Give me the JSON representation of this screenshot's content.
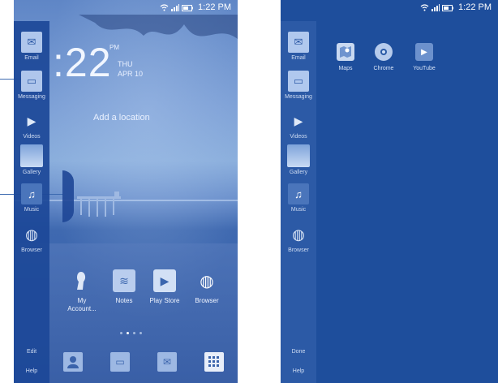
{
  "status": {
    "time": "1:22 PM",
    "wifi_icon": "wifi-icon",
    "signal_icon": "signal-icon",
    "battery_icon": "battery-icon"
  },
  "sidebar": {
    "items": [
      {
        "label": "Email",
        "icon": "email-icon"
      },
      {
        "label": "Messaging",
        "icon": "messaging-icon"
      },
      {
        "label": "Videos",
        "icon": "play-icon"
      },
      {
        "label": "Gallery",
        "icon": "gallery-icon"
      },
      {
        "label": "Music",
        "icon": "music-icon"
      },
      {
        "label": "Browser",
        "icon": "globe-icon"
      }
    ],
    "left_bottom": [
      "Edit",
      "Help"
    ],
    "right_bottom": [
      "Done",
      "Help"
    ]
  },
  "lockscreen": {
    "time": ":22",
    "ampm": "PM",
    "day": "THU",
    "date": "APR 10",
    "location": "Add a location"
  },
  "home_apps": [
    {
      "label": "My\nAccount...",
      "icon": "account-icon"
    },
    {
      "label": "Notes",
      "icon": "notes-icon"
    },
    {
      "label": "Play Store",
      "icon": "play-store-icon"
    },
    {
      "label": "Browser",
      "icon": "globe-icon"
    }
  ],
  "dock": [
    {
      "name": "contacts",
      "icon": "contact-icon"
    },
    {
      "name": "messaging",
      "icon": "messaging-icon"
    },
    {
      "name": "email",
      "icon": "email-icon"
    },
    {
      "name": "apps",
      "icon": "app-grid-icon"
    }
  ],
  "page_dots": {
    "count": 4,
    "active": 2
  },
  "edit_apps": [
    {
      "label": "Maps",
      "icon": "maps-icon"
    },
    {
      "label": "Chrome",
      "icon": "chrome-icon"
    },
    {
      "label": "YouTube",
      "icon": "youtube-icon"
    }
  ],
  "colors": {
    "accent": "#1e4e9c",
    "callout": "#3d6bb0"
  }
}
